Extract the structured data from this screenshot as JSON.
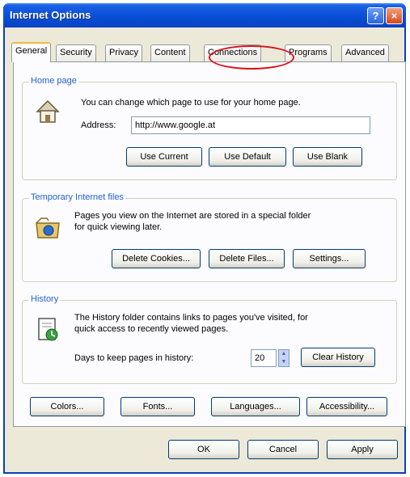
{
  "window": {
    "title": "Internet Options",
    "help_label": "?",
    "close_label": "×"
  },
  "tabs": [
    "General",
    "Security",
    "Privacy",
    "Content",
    "Connections",
    "Programs",
    "Advanced"
  ],
  "home_page": {
    "label": "Home page",
    "description": "You can change which page to use for your home page.",
    "address_label": "Address:",
    "address_value": "http://www.google.at",
    "use_current": "Use Current",
    "use_default": "Use Default",
    "use_blank": "Use Blank"
  },
  "temp_files": {
    "label": "Temporary Internet files",
    "description_line1": "Pages you view on the Internet are stored in a special folder",
    "description_line2": "for quick viewing later.",
    "delete_cookies": "Delete Cookies...",
    "delete_files": "Delete Files...",
    "settings": "Settings..."
  },
  "history": {
    "label": "History",
    "description_line1": "The History folder contains links to pages you've visited, for",
    "description_line2": "quick access to recently viewed pages.",
    "days_label": "Days to keep pages in history:",
    "days_value": "20",
    "clear_history": "Clear History"
  },
  "bottom_row": {
    "colors": "Colors...",
    "fonts": "Fonts...",
    "languages": "Languages...",
    "accessibility": "Accessibility..."
  },
  "dialog_buttons": {
    "ok": "OK",
    "cancel": "Cancel",
    "apply": "Apply"
  },
  "icons": {
    "home": "home-page-icon",
    "temp": "temporary-files-icon",
    "history": "history-icon"
  },
  "colors": {
    "titlebar": "#0a4fd8",
    "group_label": "#2360d0",
    "highlight": "#d7141d",
    "active_tab_accent": "#f8b53e"
  }
}
